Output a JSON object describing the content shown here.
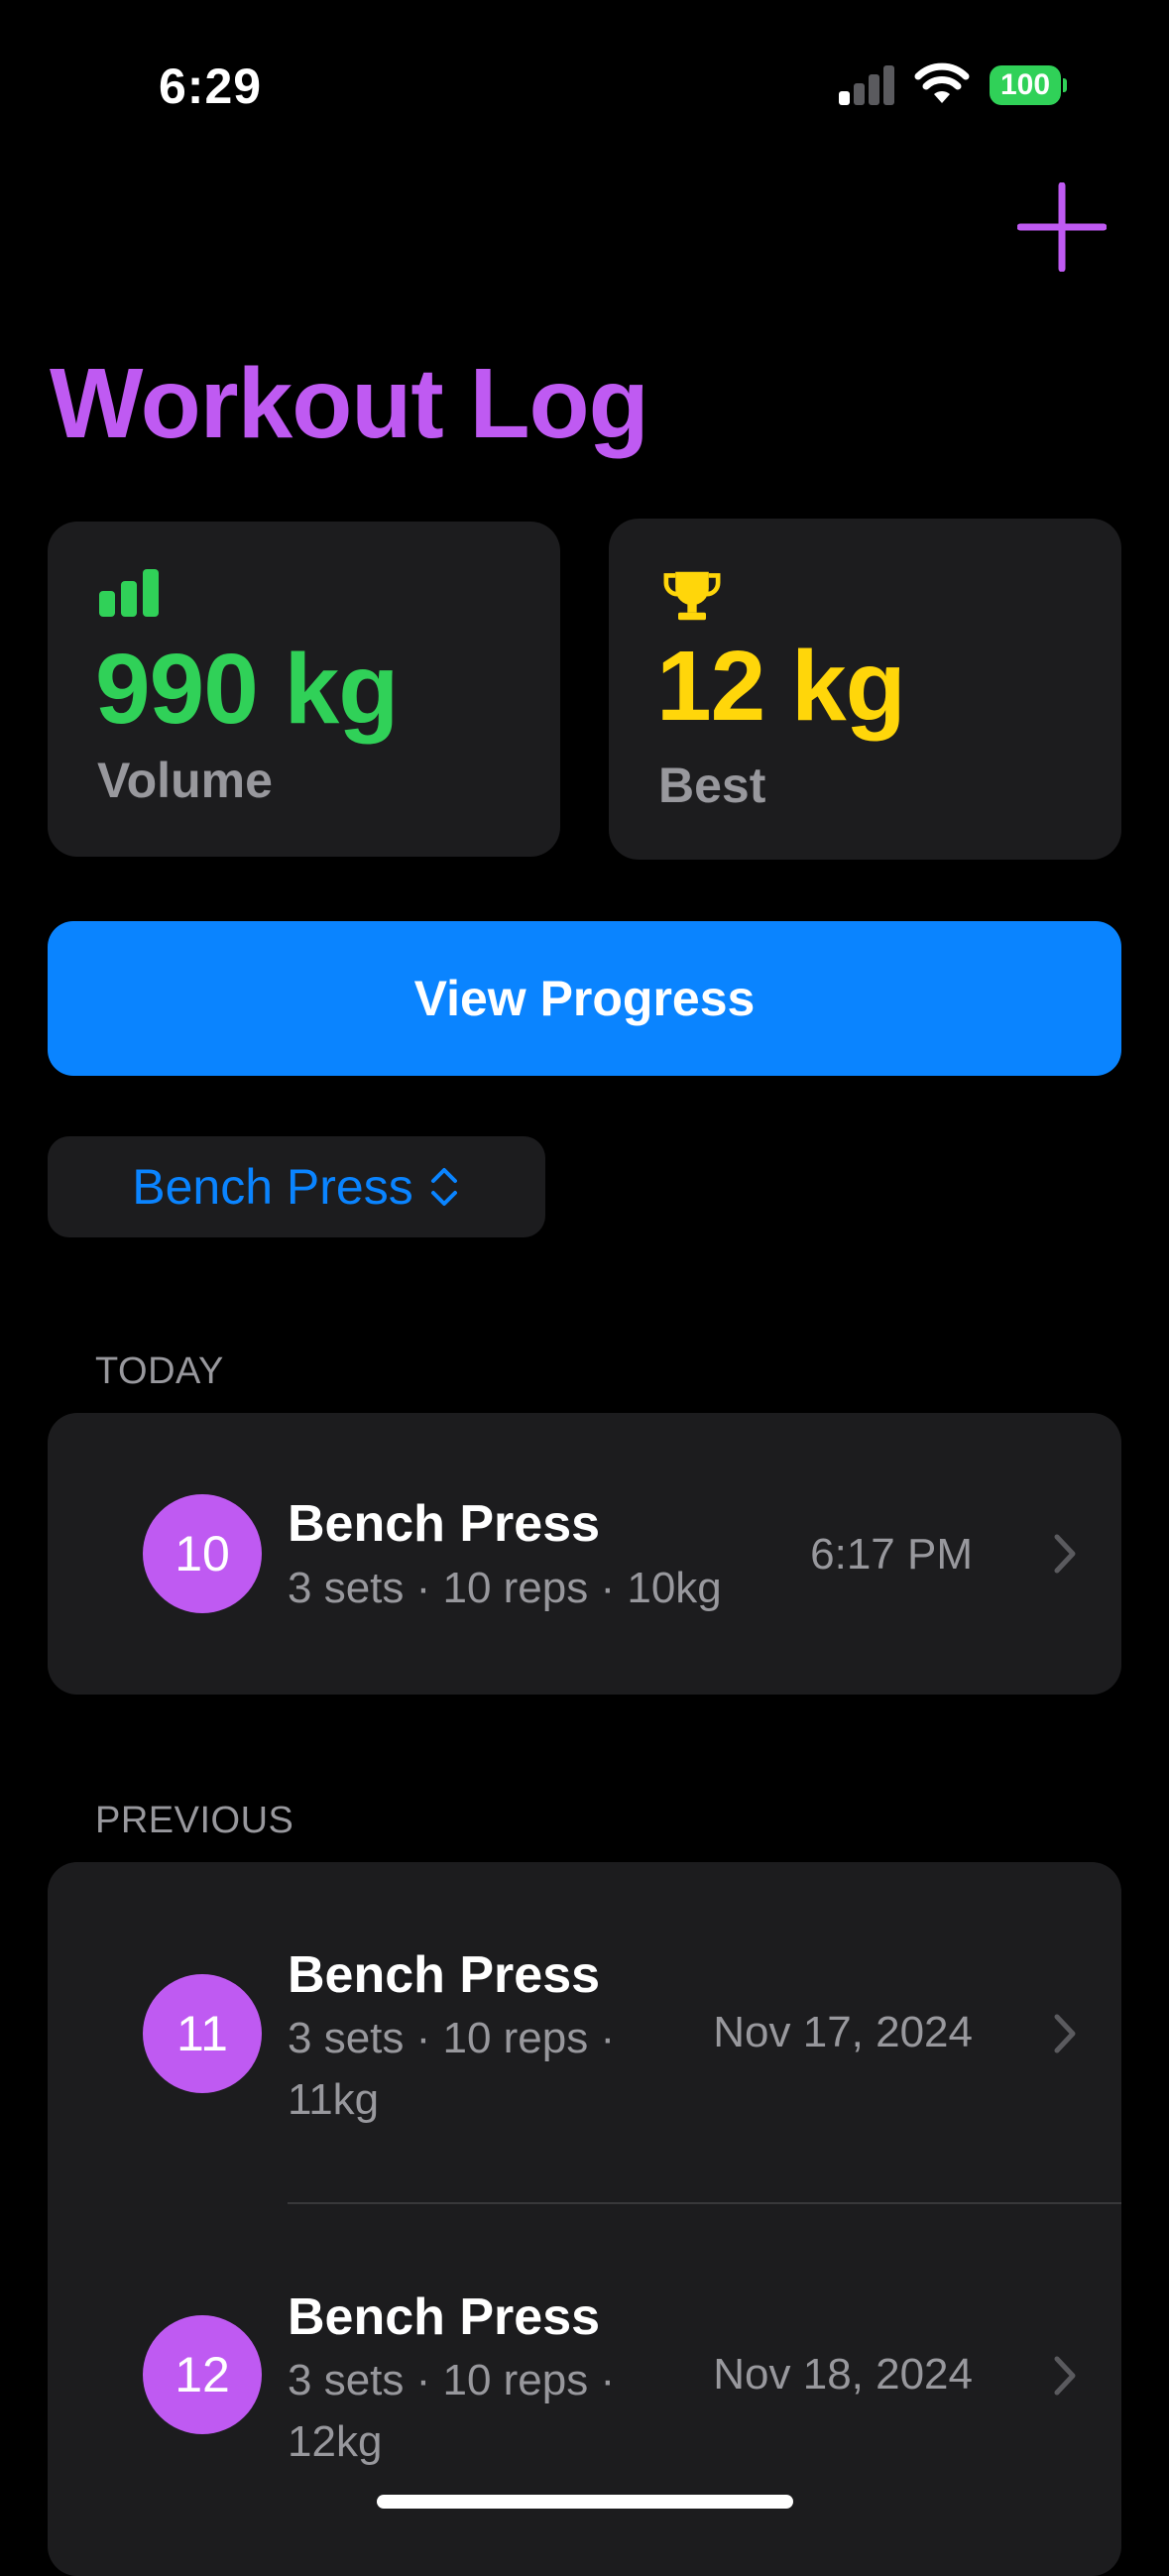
{
  "status_bar": {
    "time": "6:29",
    "battery": "100"
  },
  "header": {
    "title": "Workout Log"
  },
  "stats": {
    "volume": {
      "value": "990 kg",
      "label": "Volume",
      "color": "#30d158",
      "icon": "chart-bar-icon"
    },
    "best": {
      "value": "12 kg",
      "label": "Best",
      "color": "#ffd60a",
      "icon": "trophy-icon"
    }
  },
  "actions": {
    "view_progress_label": "View Progress"
  },
  "exercise_picker": {
    "selected": "Bench Press"
  },
  "sections": {
    "today": {
      "header": "TODAY",
      "items": [
        {
          "badge": "10",
          "title": "Bench Press",
          "subtitle": "3 sets · 10 reps · 10kg",
          "date": "6:17 PM"
        }
      ]
    },
    "previous": {
      "header": "PREVIOUS",
      "items": [
        {
          "badge": "11",
          "title": "Bench Press",
          "subtitle": "3 sets · 10 reps · 11kg",
          "date": "Nov 17, 2024"
        },
        {
          "badge": "12",
          "title": "Bench Press",
          "subtitle": "3 sets · 10 reps · 12kg",
          "date": "Nov 18, 2024"
        }
      ]
    }
  },
  "colors": {
    "accent": "#bf5af2",
    "link": "#0a84ff",
    "card": "#1c1c1e"
  }
}
